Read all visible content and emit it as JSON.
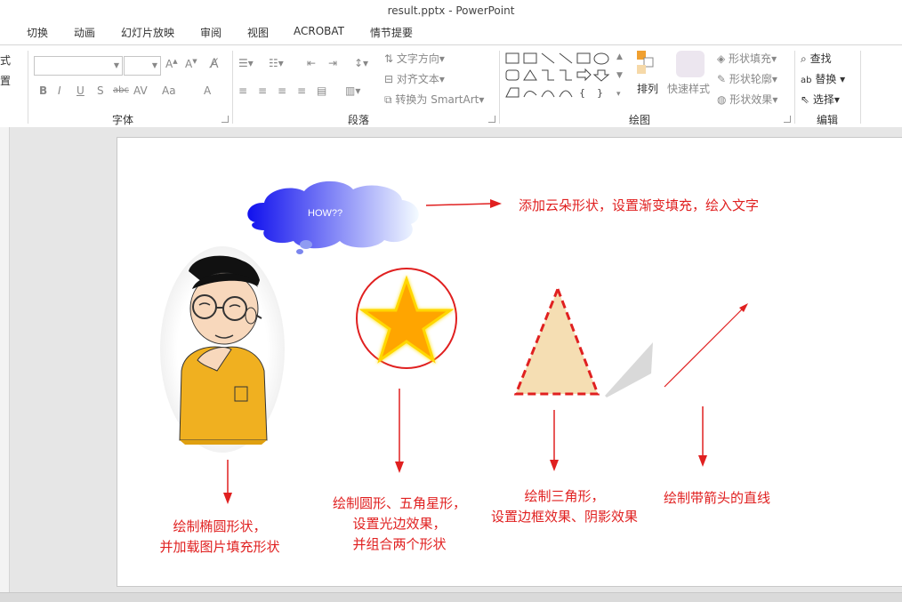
{
  "window": {
    "title": "result.pptx - PowerPoint"
  },
  "tabs": [
    "切换",
    "动画",
    "幻灯片放映",
    "审阅",
    "视图",
    "ACROBAT",
    "情节提要"
  ],
  "ribbon": {
    "left_partial": [
      "式",
      "置"
    ],
    "groups": {
      "font": "字体",
      "paragraph": "段落",
      "drawing": "绘图",
      "editing": "编辑"
    },
    "paragraph": {
      "text_direction": "文字方向",
      "align_text": "对齐文本",
      "smartart": "转换为 SmartArt"
    },
    "drawing": {
      "arrange": "排列",
      "quick_styles": "快速样式",
      "shape_fill": "形状填充",
      "shape_outline": "形状轮廓",
      "shape_effects": "形状效果"
    },
    "editing": {
      "find": "查找",
      "replace": "替换",
      "select": "选择"
    }
  },
  "slide": {
    "cloud_text": "HOW??",
    "note_cloud": "添加云朵形状，设置渐变填充，绘入文字",
    "note_ellipse": [
      "绘制椭圆形状，",
      "并加载图片填充形状"
    ],
    "note_star": [
      "绘制圆形、五角星形，",
      "设置光边效果，",
      "并组合两个形状"
    ],
    "note_triangle": [
      "绘制三角形，",
      "设置边框效果、阴影效果"
    ],
    "note_line": "绘制带箭头的直线"
  },
  "colors": {
    "annotation_red": "#e02020",
    "star_fill": "#ffa500",
    "triangle_fill": "#f5deb3"
  }
}
